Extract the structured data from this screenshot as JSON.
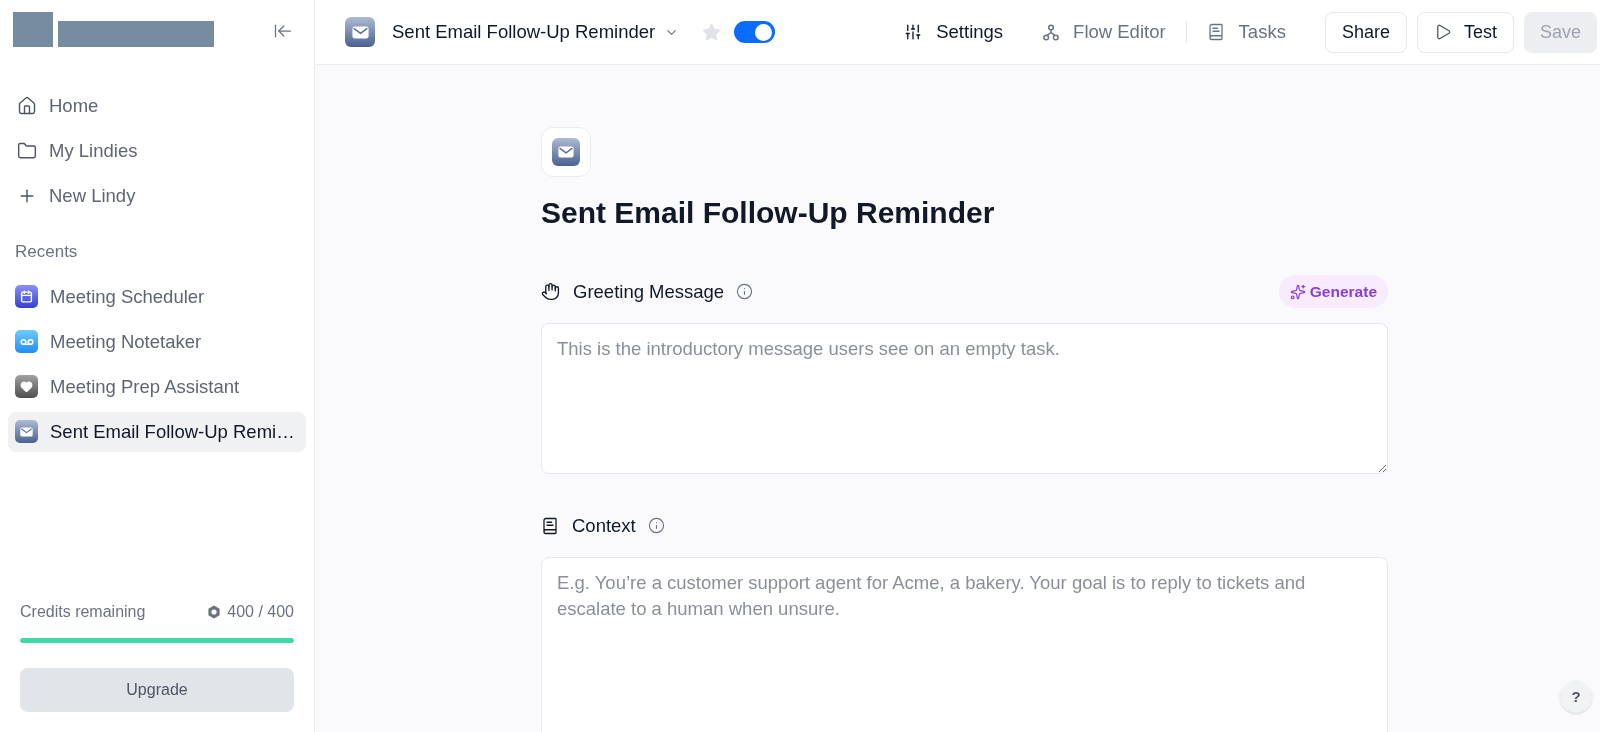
{
  "sidebar": {
    "nav": [
      {
        "label": "Home",
        "selected": false
      },
      {
        "label": "My Lindies",
        "selected": false
      },
      {
        "label": "New Lindy",
        "selected": false
      }
    ],
    "recents_heading": "Recents",
    "recents": [
      {
        "label": "Meeting Scheduler",
        "selected": false
      },
      {
        "label": "Meeting Notetaker",
        "selected": false
      },
      {
        "label": "Meeting Prep Assistant",
        "selected": false
      },
      {
        "label": "Sent Email Follow-Up Remi…",
        "selected": true
      }
    ],
    "credits": {
      "label": "Credits remaining",
      "reading": "400 / 400",
      "level": 1
    },
    "upgrade_button": "Upgrade"
  },
  "topbar": {
    "title": "Sent Email Follow-Up Reminder",
    "starred": false,
    "enabled": true,
    "tabs": [
      {
        "label": "Settings",
        "selected": true
      },
      {
        "label": "Flow Editor",
        "selected": false
      },
      {
        "label": "Tasks",
        "selected": false
      }
    ],
    "buttons": [
      {
        "label": "Share",
        "disabled": false
      },
      {
        "label": "Test",
        "disabled": false
      },
      {
        "label": "Save",
        "disabled": true
      }
    ]
  },
  "page": {
    "title": "Sent Email Follow-Up Reminder",
    "fields": [
      {
        "label": "Greeting Message",
        "generate_button": "Generate",
        "placeholder": "This is the introductory message users see on an empty task."
      },
      {
        "label": "Context",
        "placeholder": "E.g. You’re a customer support agent for Acme, a bakery. Your goal is to reply to tickets and escalate to a human when unsure."
      }
    ]
  },
  "help_button": "?"
}
